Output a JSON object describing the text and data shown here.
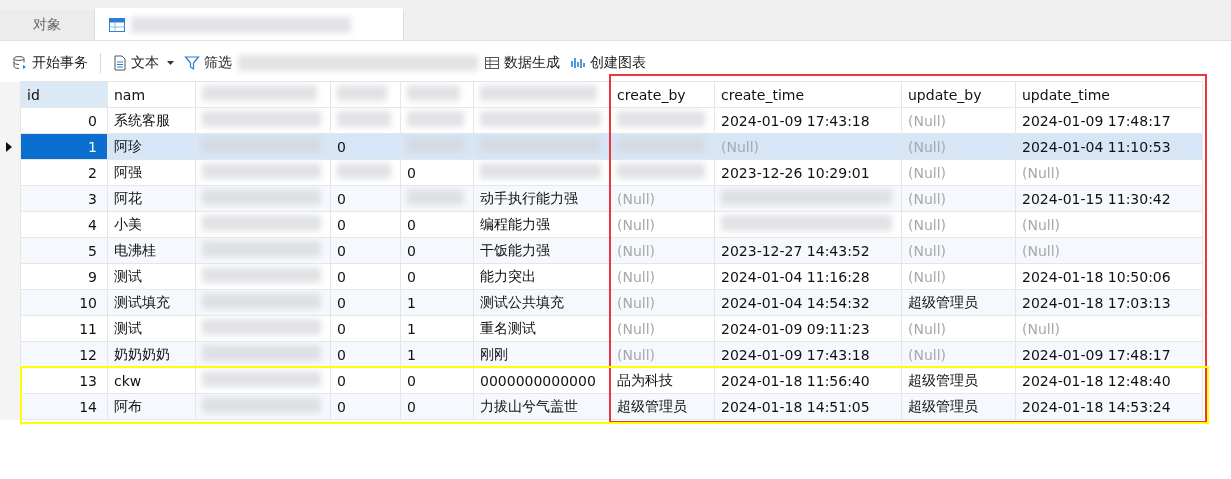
{
  "tabs": [
    {
      "label": "对象",
      "kind": "text",
      "selected": false
    },
    {
      "kind": "table",
      "redacted": true,
      "selected": true
    }
  ],
  "toolbar": [
    {
      "label": "开始事务",
      "kind": "database"
    },
    {
      "label": "文本",
      "kind": "document",
      "dropdown": true
    },
    {
      "label": "筛选",
      "kind": "filter"
    },
    {
      "redacted": true
    },
    {
      "label": "数据生成",
      "kind": "grid"
    },
    {
      "label": "创建图表",
      "kind": "chart"
    }
  ],
  "table": {
    "columns": [
      "id",
      "nam",
      null,
      null,
      null,
      null,
      "create_by",
      "create_time",
      "update_by",
      "update_time"
    ],
    "rows": [
      {
        "selected": false,
        "cells": [
          "0",
          "系统客服",
          null,
          null,
          null,
          null,
          null,
          "2024-01-09 17:43:18",
          {
            "text": "(Null)",
            "null": true
          },
          "2024-01-09 17:48:17"
        ]
      },
      {
        "selected": true,
        "cells": [
          "1",
          "阿珍",
          null,
          "0",
          null,
          null,
          null,
          {
            "text": "(Null)",
            "null": true
          },
          {
            "text": "(Null)",
            "null": true
          },
          "2024-01-04 11:10:53"
        ]
      },
      {
        "selected": false,
        "cells": [
          "2",
          "阿强",
          null,
          null,
          "0",
          null,
          null,
          "2023-12-26 10:29:01",
          {
            "text": "(Null)",
            "null": true
          },
          {
            "text": "(Null)",
            "null": true
          }
        ]
      },
      {
        "selected": false,
        "cells": [
          "3",
          "阿花",
          null,
          "0",
          null,
          "动手执行能力强",
          {
            "text": "(Null)",
            "null": true
          },
          null,
          {
            "text": "(Null)",
            "null": true
          },
          "2024-01-15 11:30:42"
        ]
      },
      {
        "selected": false,
        "cells": [
          "4",
          "小美",
          null,
          "0",
          "0",
          "编程能力强",
          {
            "text": "(Null)",
            "null": true
          },
          null,
          {
            "text": "(Null)",
            "null": true
          },
          {
            "text": "(Null)",
            "null": true
          }
        ]
      },
      {
        "selected": false,
        "cells": [
          "5",
          "电沸桂",
          null,
          "0",
          "0",
          "干饭能力强",
          {
            "text": "(Null)",
            "null": true
          },
          "2023-12-27 14:43:52",
          {
            "text": "(Null)",
            "null": true
          },
          {
            "text": "(Null)",
            "null": true
          }
        ]
      },
      {
        "selected": false,
        "cells": [
          "9",
          "测试",
          null,
          "0",
          "0",
          "能力突出",
          {
            "text": "(Null)",
            "null": true
          },
          "2024-01-04 11:16:28",
          {
            "text": "(Null)",
            "null": true
          },
          "2024-01-18 10:50:06"
        ]
      },
      {
        "selected": false,
        "cells": [
          "10",
          "测试填充",
          null,
          "0",
          "1",
          "测试公共填充",
          {
            "text": "(Null)",
            "null": true
          },
          "2024-01-04 14:54:32",
          "超级管理员",
          "2024-01-18 17:03:13"
        ]
      },
      {
        "selected": false,
        "cells": [
          "11",
          "测试",
          null,
          "0",
          "1",
          "重名测试",
          {
            "text": "(Null)",
            "null": true
          },
          "2024-01-09 09:11:23",
          {
            "text": "(Null)",
            "null": true
          },
          {
            "text": "(Null)",
            "null": true
          }
        ]
      },
      {
        "selected": false,
        "cells": [
          "12",
          "奶奶奶奶",
          null,
          "0",
          "1",
          "刚刚",
          {
            "text": "(Null)",
            "null": true
          },
          "2024-01-09 17:43:18",
          {
            "text": "(Null)",
            "null": true
          },
          "2024-01-09 17:48:17"
        ]
      },
      {
        "selected": false,
        "cells": [
          "13",
          "ckw",
          null,
          "0",
          "0",
          "0000000000000",
          "品为科技",
          "2024-01-18 11:56:40",
          "超级管理员",
          "2024-01-18 12:48:40"
        ]
      },
      {
        "selected": false,
        "cells": [
          "14",
          "阿布",
          null,
          "0",
          "0",
          "力拔山兮气盖世",
          "超级管理员",
          "2024-01-18 14:51:05",
          "超级管理员",
          "2024-01-18 14:53:24"
        ]
      }
    ]
  },
  "annotations": [
    {
      "kind": "columns",
      "color": "#e8383d"
    },
    {
      "kind": "rows",
      "color": "#ffff00"
    }
  ]
}
